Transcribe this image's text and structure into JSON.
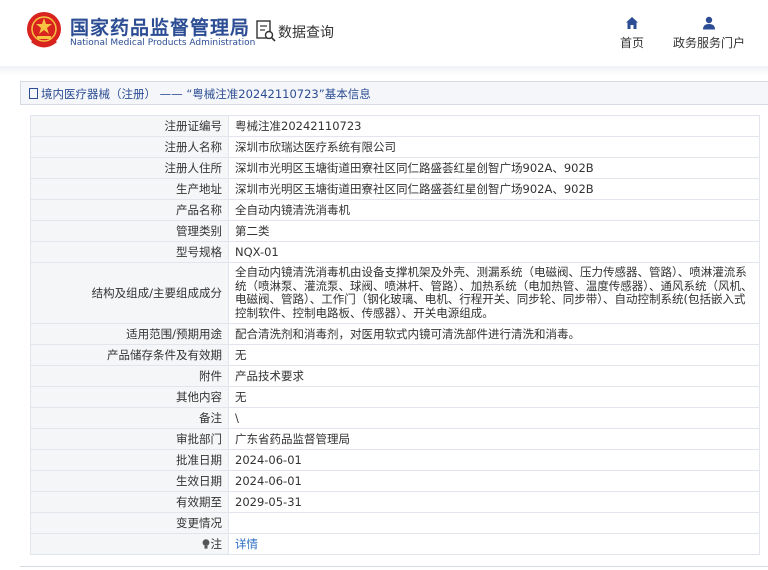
{
  "header": {
    "brand_cn": "国家药品监督管理局",
    "brand_en": "National Medical Products Administration",
    "data_query": "数据查询",
    "nav_home": "首页",
    "nav_service": "政务服务门户",
    "brand_color": "#2c4d94",
    "emblem_color": "#d8231e"
  },
  "breadcrumb": {
    "category": "境内医疗器械（注册）",
    "separator": "——",
    "title": "“粤械注准20242110723”基本信息"
  },
  "rows": [
    {
      "label": "注册证编号",
      "value": "粤械注准20242110723"
    },
    {
      "label": "注册人名称",
      "value": "深圳市欣瑞达医疗系统有限公司"
    },
    {
      "label": "注册人住所",
      "value": "深圳市光明区玉塘街道田寮社区同仁路盛荟红星创智广场902A、902B"
    },
    {
      "label": "生产地址",
      "value": "深圳市光明区玉塘街道田寮社区同仁路盛荟红星创智广场902A、902B"
    },
    {
      "label": "产品名称",
      "value": "全自动内镜清洗消毒机"
    },
    {
      "label": "管理类别",
      "value": "第二类"
    },
    {
      "label": "型号规格",
      "value": "NQX-01"
    },
    {
      "label": "结构及组成/主要组成成分",
      "value": "全自动内镜清洗消毒机由设备支撑机架及外壳、测漏系统（电磁阀、压力传感器、管路）、喷淋灌流系统（喷淋泵、灌流泵、球阀、喷淋杆、管路）、加热系统（电加热管、温度传感器）、通风系统（风机、电磁阀、管路）、工作门（钢化玻璃、电机、行程开关、同步轮、同步带）、自动控制系统(包括嵌入式控制软件、控制电路板、传感器）、开关电源组成。"
    },
    {
      "label": "适用范围/预期用途",
      "value": "配合清洗剂和消毒剂，对医用软式内镜可清洗部件进行清洗和消毒。"
    },
    {
      "label": "产品储存条件及有效期",
      "value": "无"
    },
    {
      "label": "附件",
      "value": "产品技术要求"
    },
    {
      "label": "其他内容",
      "value": "无"
    },
    {
      "label": "备注",
      "value": "\\"
    },
    {
      "label": "审批部门",
      "value": "广东省药品监督管理局"
    },
    {
      "label": "批准日期",
      "value": "2024-06-01"
    },
    {
      "label": "生效日期",
      "value": "2024-06-01"
    },
    {
      "label": "有效期至",
      "value": "2029-05-31"
    },
    {
      "label": "变更情况",
      "value": ""
    }
  ],
  "note": {
    "label": "注",
    "link": "详情",
    "link_color": "#2b6ec2"
  }
}
